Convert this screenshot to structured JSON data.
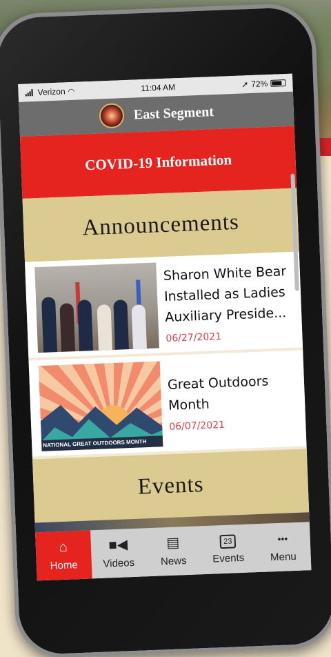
{
  "status_bar": {
    "carrier": "Verizon",
    "time": "11:04 AM",
    "battery": "72%"
  },
  "header": {
    "title": "East Segment"
  },
  "covid_banner": {
    "label": "COVID-19 Information"
  },
  "announcements": {
    "heading": "Announcements",
    "items": [
      {
        "title": "Sharon White Bear Installed as Ladies Auxiliary Preside...",
        "date": "06/27/2021"
      },
      {
        "title": "Great Outdoors Month",
        "date": "06/07/2021",
        "banner": "NATIONAL GREAT OUTDOORS MONTH"
      }
    ]
  },
  "events": {
    "heading": "Events"
  },
  "tabbar": {
    "items": [
      {
        "label": "Home",
        "icon": "home-icon"
      },
      {
        "label": "Videos",
        "icon": "video-camera-icon"
      },
      {
        "label": "News",
        "icon": "newspaper-icon"
      },
      {
        "label": "Events",
        "icon": "calendar-icon",
        "icon_text": "23"
      },
      {
        "label": "Menu",
        "icon": "more-icon",
        "icon_text": "•••"
      }
    ]
  },
  "colors": {
    "accent_red": "#e5231f",
    "section_tan": "#dccb91",
    "header_gray": "#6d6d6d"
  }
}
